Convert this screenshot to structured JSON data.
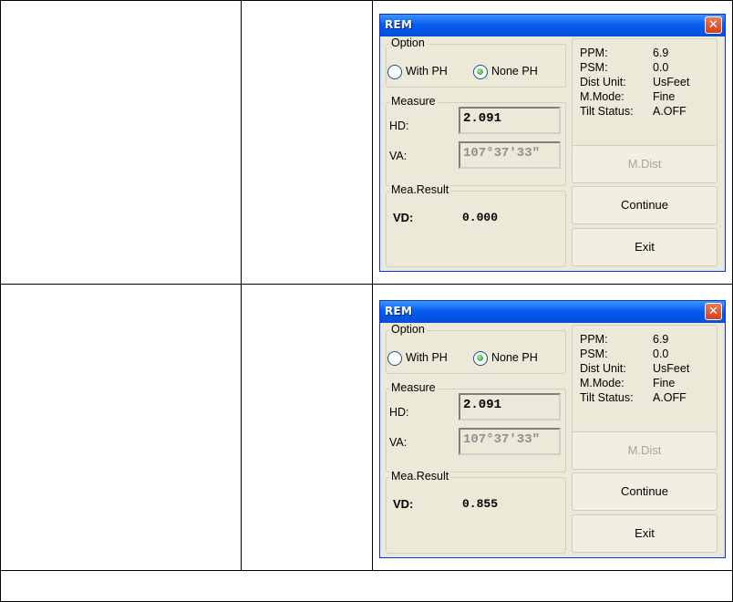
{
  "dialogs": [
    {
      "title": "REM",
      "option": {
        "group_label": "Option",
        "with_ph": "With PH",
        "none_ph": "None PH",
        "selected": "None PH"
      },
      "measure": {
        "group_label": "Measure",
        "hd_label": "HD:",
        "hd_value": "2.091",
        "va_label": "VA:",
        "va_value": "107°37′33″"
      },
      "result": {
        "group_label": "Mea.Result",
        "vd_label": "VD:",
        "vd_value": "0.000"
      },
      "status": {
        "ppm_label": "PPM:",
        "ppm_value": "6.9",
        "psm_label": "PSM:",
        "psm_value": "0.0",
        "dist_unit_label": "Dist Unit:",
        "dist_unit_value": "UsFeet",
        "mmode_label": "M.Mode:",
        "mmode_value": "Fine",
        "tilt_label": "Tilt Status:",
        "tilt_value": "A.OFF"
      },
      "buttons": {
        "mdist": "M.Dist",
        "continue": "Continue",
        "exit": "Exit"
      }
    },
    {
      "title": "REM",
      "option": {
        "group_label": "Option",
        "with_ph": "With PH",
        "none_ph": "None PH",
        "selected": "None PH"
      },
      "measure": {
        "group_label": "Measure",
        "hd_label": "HD:",
        "hd_value": "2.091",
        "va_label": "VA:",
        "va_value": "107°37′33″"
      },
      "result": {
        "group_label": "Mea.Result",
        "vd_label": "VD:",
        "vd_value": "0.855"
      },
      "status": {
        "ppm_label": "PPM:",
        "ppm_value": "6.9",
        "psm_label": "PSM:",
        "psm_value": "0.0",
        "dist_unit_label": "Dist Unit:",
        "dist_unit_value": "UsFeet",
        "mmode_label": "M.Mode:",
        "mmode_value": "Fine",
        "tilt_label": "Tilt Status:",
        "tilt_value": "A.OFF"
      },
      "buttons": {
        "mdist": "M.Dist",
        "continue": "Continue",
        "exit": "Exit"
      }
    }
  ]
}
